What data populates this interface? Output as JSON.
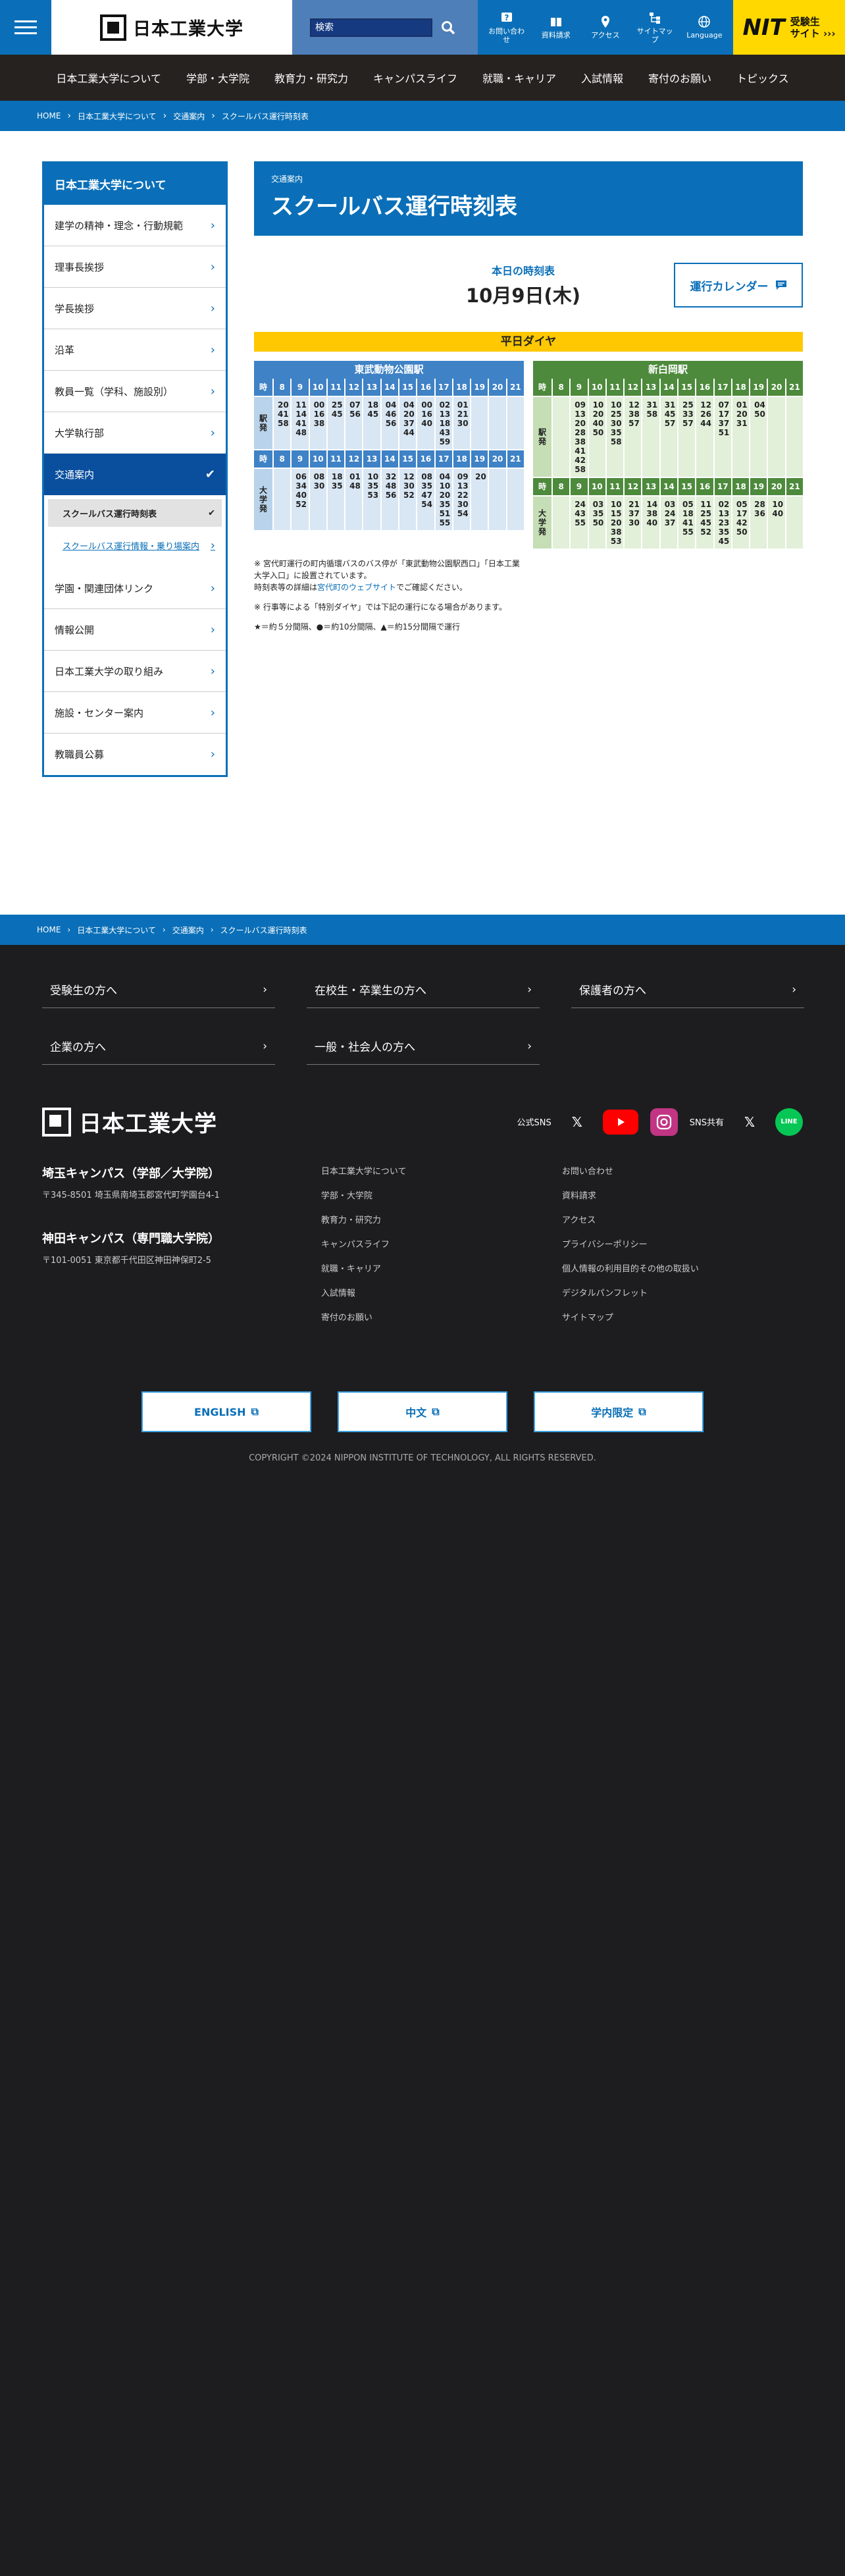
{
  "header": {
    "logo_text": "日本工業大学",
    "search_placeholder": "検索",
    "utils": [
      "お問い合わせ",
      "資料請求",
      "アクセス",
      "サイトマップ",
      "Language"
    ],
    "nit_logo": "NIT",
    "nit_text1": "受験生",
    "nit_text2": "サイト ›››"
  },
  "gnav": [
    "日本工業大学について",
    "学部・大学院",
    "教育力・研究力",
    "キャンパスライフ",
    "就職・キャリア",
    "入試情報",
    "寄付のお願い",
    "トピックス"
  ],
  "breadcrumb": [
    "HOME",
    "日本工業大学について",
    "交通案内",
    "スクールバス運行時刻表"
  ],
  "sidebar": {
    "title": "日本工業大学について",
    "items": [
      "建学の精神・理念・行動規範",
      "理事長挨拶",
      "学長挨拶",
      "沿革",
      "教員一覧（学科、施設別）",
      "大学執行部"
    ],
    "active": "交通案内",
    "sub1": "スクールバス運行時刻表",
    "sub2": "スクールバス運行情報・乗り場案内",
    "items2": [
      "学園・関連団体リンク",
      "情報公開",
      "日本工業大学の取り組み",
      "施設・センター案内",
      "教職員公募"
    ]
  },
  "page": {
    "subtitle": "交通案内",
    "title": "スクールバス運行時刻表",
    "today_label": "本日の時刻表",
    "today_date": "10月9日(木)",
    "calendar_btn": "運行カレンダー",
    "schedule_label": "平日ダイヤ"
  },
  "timetables": {
    "hour_label": "時",
    "hours": [
      "8",
      "9",
      "10",
      "11",
      "12",
      "13",
      "14",
      "15",
      "16",
      "17",
      "18",
      "19",
      "20",
      "21"
    ],
    "left": {
      "name": "東武動物公園駅",
      "color": "#3f82c6",
      "light": "#d9e6f3",
      "label_color": "#b9d3ea",
      "row1_label": "駅発",
      "row1": [
        "20\n41\n58",
        "11\n14\n41\n48",
        "00\n16\n38",
        "25\n45",
        "07\n56",
        "18\n45",
        "04\n46\n56",
        "04\n20\n37\n44",
        "00\n16\n40",
        "02\n13\n18\n43\n59",
        "01\n21\n30",
        "",
        "",
        ""
      ],
      "row2_label": "大学発",
      "row2": [
        "",
        "06\n34\n40\n52",
        "08\n30",
        "18\n35",
        "01\n48",
        "10\n35\n53",
        "32\n48\n56",
        "12\n30\n52",
        "08\n35\n47\n54",
        "04\n10\n20\n35\n51\n55",
        "09\n13\n22\n30\n54",
        "20",
        "",
        ""
      ]
    },
    "right": {
      "name": "新白岡駅",
      "color": "#4d8a3c",
      "light": "#e2efd9",
      "label_color": "#c5deb5",
      "row1_label": "駅発",
      "row1": [
        "",
        "09\n13\n20\n28\n38\n41\n42\n58",
        "10\n20\n40\n50",
        "10\n25\n30\n35\n58",
        "12\n38\n57",
        "31\n58",
        "31\n45\n57",
        "25\n33\n57",
        "12\n26\n44",
        "07\n17\n37\n51",
        "01\n20\n31",
        "04\n50",
        "",
        ""
      ],
      "row2_label": "大学発",
      "row2": [
        "",
        "24\n43\n55",
        "03\n35\n50",
        "10\n15\n20\n38\n53",
        "21\n37\n30",
        "14\n38\n40",
        "03\n24\n37",
        "05\n18\n41\n55",
        "11\n25\n45\n52",
        "02\n13\n23\n35\n45",
        "05\n17\n42\n50",
        "28\n36",
        "10\n40",
        ""
      ]
    }
  },
  "notes": {
    "n1": "※ 宮代町運行の町内循環バスのバス停が「東武動物公園駅西口」「日本工業大学入口」に設置されています。",
    "n1b_pre": "時刻表等の詳細は",
    "n1b_link": "宮代町のウェブサイト",
    "n1b_post": "でご確認ください。",
    "n2": "※ 行事等による「特別ダイヤ」では下記の運行になる場合があります。",
    "n3": "★＝約５分間隔、●＝約10分間隔、▲＝約15分間隔で運行"
  },
  "footer": {
    "links": [
      "受験生の方へ",
      "在校生・卒業生の方へ",
      "保護者の方へ",
      "企業の方へ",
      "一般・社会人の方へ"
    ],
    "logo_text": "日本工業大学",
    "sns_label": "公式SNS",
    "share_label": "SNS共有",
    "campus1_name": "埼玉キャンパス（学部／大学院）",
    "campus1_addr": "〒345-8501 埼玉県南埼玉郡宮代町学園台4-1",
    "campus2_name": "神田キャンパス（専門職大学院）",
    "campus2_addr": "〒101-0051 東京都千代田区神田神保町2-5",
    "col1": [
      "日本工業大学について",
      "学部・大学院",
      "教育力・研究力",
      "キャンパスライフ",
      "就職・キャリア",
      "入試情報",
      "寄付のお願い"
    ],
    "col2": [
      "お問い合わせ",
      "資料請求",
      "アクセス",
      "プライバシーポリシー",
      "個人情報の利用目的その他の取扱い",
      "デジタルパンフレット",
      "サイトマップ"
    ],
    "langs": [
      "ENGLISH",
      "中文",
      "学内限定"
    ],
    "copyright": "COPYRIGHT ©2024 NIPPON INSTITUTE OF TECHNOLOGY, ALL RIGHTS RESERVED."
  }
}
